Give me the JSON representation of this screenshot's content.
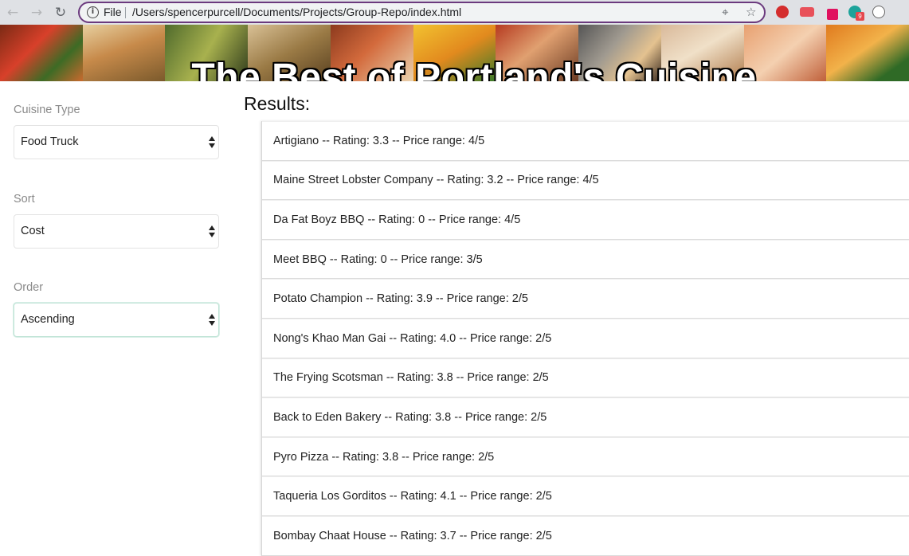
{
  "browser": {
    "scheme_label": "File",
    "url": "/Users/spencerpurcell/Documents/Projects/Group-Repo/index.html",
    "icons": [
      "back-arrow-icon",
      "forward-arrow-icon",
      "reload-icon",
      "info-icon",
      "location-icon",
      "star-icon"
    ],
    "extension_badge": "9"
  },
  "header": {
    "title": "The Best of Portland's Cuisine"
  },
  "filters": {
    "cuisine_label": "Cuisine Type",
    "cuisine_value": "Food Truck",
    "sort_label": "Sort",
    "sort_value": "Cost",
    "order_label": "Order",
    "order_value": "Ascending"
  },
  "results": {
    "heading": "Results:",
    "items": [
      "Artigiano -- Rating: 3.3 -- Price range: 4/5",
      "Maine Street Lobster Company -- Rating: 3.2 -- Price range: 4/5",
      "Da Fat Boyz BBQ -- Rating: 0 -- Price range: 4/5",
      "Meet BBQ -- Rating: 0 -- Price range: 3/5",
      "Potato Champion -- Rating: 3.9 -- Price range: 2/5",
      "Nong's Khao Man Gai -- Rating: 4.0 -- Price range: 2/5",
      "The Frying Scotsman -- Rating: 3.8 -- Price range: 2/5",
      "Back to Eden Bakery -- Rating: 3.8 -- Price range: 2/5",
      "Pyro Pizza -- Rating: 3.8 -- Price range: 2/5",
      "Taqueria Los Gorditos -- Rating: 4.1 -- Price range: 2/5",
      "Bombay Chaat House -- Rating: 3.7 -- Price range: 2/5"
    ]
  },
  "colors": {
    "omnibox_focus": "#6b3a7e",
    "order_select_focus": "#bfe3d6"
  }
}
